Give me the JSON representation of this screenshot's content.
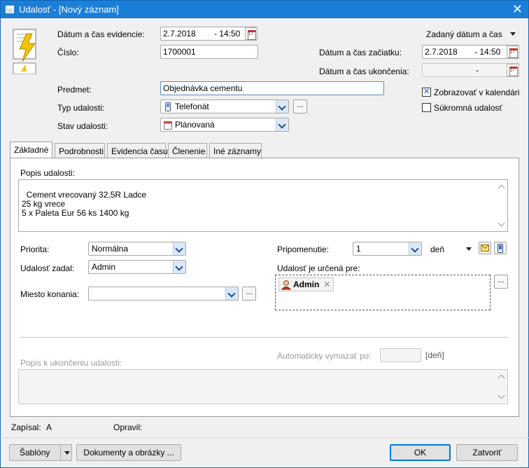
{
  "window": {
    "title": "Udalosť - [Nový záznam]",
    "close_glyph": "✕"
  },
  "header": {
    "icon": "lightning-document-icon",
    "datum_evidencie_label": "Dátum a čas evidencie:",
    "datum_evidencie_date": "2.7.2018",
    "datum_evidencie_time": "- 14:50",
    "cislo_label": "Číslo:",
    "cislo_value": "1700001",
    "predmet_label": "Predmet:",
    "predmet_value": "Objednávka cementu",
    "typ_label": "Typ udalosti:",
    "typ_value": "Telefonát",
    "stav_label": "Stav udalosti:",
    "stav_value": "Plánovaná",
    "dots": "..."
  },
  "right_panel": {
    "mode_dropdown": "Zadaný dátum a čas",
    "zaciatok_label": "Dátum a čas začiatku:",
    "zaciatok_date": "2.7.2018",
    "zaciatok_time": "- 14:50",
    "ukoncenie_label": "Dátum a čas ukončenia:",
    "ukoncenie_value": "-",
    "zobrazovat_label": "Zobrazovať v kalendári",
    "zobrazovat_checked": true,
    "sukromna_label": "Súkromná udalosť",
    "sukromna_checked": false
  },
  "tabs": [
    {
      "label": "Základné",
      "active": true
    },
    {
      "label": "Podrobnosti",
      "active": false
    },
    {
      "label": "Evidencia času",
      "active": false
    },
    {
      "label": "Členenie",
      "active": false
    },
    {
      "label": "Iné záznamy",
      "active": false
    }
  ],
  "zakladne": {
    "popis_label": "Popis udalosti:",
    "popis_text": "Cement vrecovaný 32,5R Ladce\n25 kg vrece\n5 x Paleta Eur 56 ks 1400 kg",
    "priorita_label": "Priorita:",
    "priorita_value": "Normálna",
    "zadal_label": "Udalosť zadal:",
    "zadal_value": "Admin",
    "miesto_label": "Miesto konania:",
    "miesto_value": "",
    "pripomenutie_label": "Pripomenutie:",
    "pripomenutie_value": "1",
    "pripomenutie_unit": "deň",
    "urcena_label": "Udalosť je určená pre:",
    "urcena_user": "Admin",
    "chip_remove": "✕",
    "auto_label": "Automaticky vymazať po:",
    "auto_value": "",
    "auto_unit": "[deň]",
    "popis_ukoncenia_label": "Popis k ukončeniu udalosti:",
    "popis_ukoncenia_text": ""
  },
  "footer": {
    "zapisal_label": "Zapísal:",
    "zapisal_value": "A",
    "opravil_label": "Opravil:",
    "opravil_value": ""
  },
  "buttons": {
    "sablony": "Šablóny",
    "dokumenty": "Dokumenty a obrázky ...",
    "ok": "OK",
    "zavriet": "Zatvoriť"
  },
  "colors": {
    "titlebar": "#1b7fd7",
    "combo_arrow_bg": "#dbe8f7",
    "default_button_border": "#0078d7"
  }
}
